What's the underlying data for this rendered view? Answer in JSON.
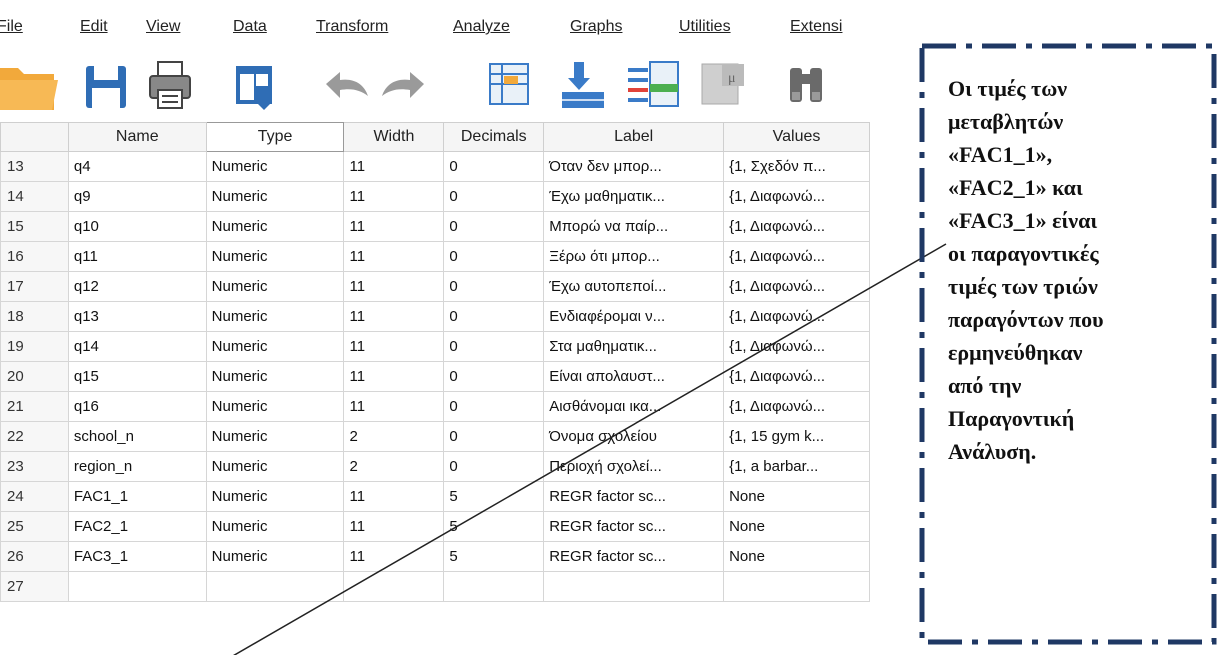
{
  "menu": {
    "items": [
      "File",
      "Edit",
      "View",
      "Data",
      "Transform",
      "Analyze",
      "Graphs",
      "Utilities",
      "Extensi"
    ]
  },
  "toolbar": {
    "icons": [
      "open-folder-icon",
      "save-icon",
      "print-icon",
      "dialog-recall-icon",
      "undo-icon",
      "redo-icon",
      "go-to-case-icon",
      "go-to-variable-icon",
      "variables-icon",
      "run-descriptives-icon",
      "find-icon"
    ]
  },
  "grid": {
    "columns": [
      "",
      "Name",
      "Type",
      "Width",
      "Decimals",
      "Label",
      "Values"
    ],
    "rows": [
      {
        "num": "13",
        "name": "q4",
        "type": "Numeric",
        "width": "11",
        "decimals": "0",
        "label": "Όταν δεν μπορ...",
        "values": "{1, Σχεδόν π..."
      },
      {
        "num": "14",
        "name": "q9",
        "type": "Numeric",
        "width": "11",
        "decimals": "0",
        "label": "Έχω μαθηματικ...",
        "values": "{1, Διαφωνώ..."
      },
      {
        "num": "15",
        "name": "q10",
        "type": "Numeric",
        "width": "11",
        "decimals": "0",
        "label": "Μπορώ να παίρ...",
        "values": "{1, Διαφωνώ..."
      },
      {
        "num": "16",
        "name": "q11",
        "type": "Numeric",
        "width": "11",
        "decimals": "0",
        "label": "Ξέρω ότι μπορ...",
        "values": "{1, Διαφωνώ..."
      },
      {
        "num": "17",
        "name": "q12",
        "type": "Numeric",
        "width": "11",
        "decimals": "0",
        "label": "Έχω αυτοπεποί...",
        "values": "{1, Διαφωνώ..."
      },
      {
        "num": "18",
        "name": "q13",
        "type": "Numeric",
        "width": "11",
        "decimals": "0",
        "label": "Ενδιαφέρομαι ν...",
        "values": "{1, Διαφωνώ..."
      },
      {
        "num": "19",
        "name": "q14",
        "type": "Numeric",
        "width": "11",
        "decimals": "0",
        "label": "Στα μαθηματικ...",
        "values": "{1, Διαφωνώ..."
      },
      {
        "num": "20",
        "name": "q15",
        "type": "Numeric",
        "width": "11",
        "decimals": "0",
        "label": "Είναι απολαυστ...",
        "values": "{1, Διαφωνώ..."
      },
      {
        "num": "21",
        "name": "q16",
        "type": "Numeric",
        "width": "11",
        "decimals": "0",
        "label": "Αισθάνομαι ικα...",
        "values": "{1, Διαφωνώ..."
      },
      {
        "num": "22",
        "name": "school_n",
        "type": "Numeric",
        "width": "2",
        "decimals": "0",
        "label": "Όνομα σχολείου",
        "values": "{1, 15 gym k..."
      },
      {
        "num": "23",
        "name": "region_n",
        "type": "Numeric",
        "width": "2",
        "decimals": "0",
        "label": "Περιοχή σχολεί...",
        "values": "{1, a barbar..."
      },
      {
        "num": "24",
        "name": "FAC1_1",
        "type": "Numeric",
        "width": "11",
        "decimals": "5",
        "label": "REGR factor sc...",
        "values": "None"
      },
      {
        "num": "25",
        "name": "FAC2_1",
        "type": "Numeric",
        "width": "11",
        "decimals": "5",
        "label": "REGR factor sc...",
        "values": "None"
      },
      {
        "num": "26",
        "name": "FAC3_1",
        "type": "Numeric",
        "width": "11",
        "decimals": "5",
        "label": "REGR factor sc...",
        "values": "None"
      },
      {
        "num": "27",
        "name": "",
        "type": "",
        "width": "",
        "decimals": "",
        "label": "",
        "values": ""
      }
    ]
  },
  "callout": {
    "lines": [
      "Οι τιμές των",
      "μεταβλητών",
      "«FAC1_1»,",
      "«FAC2_1» και",
      "«FAC3_1» είναι",
      "οι παραγοντικές",
      "τιμές των τριών",
      "παραγόντων που",
      "ερμηνεύθηκαν",
      "από την",
      "Παραγοντική",
      "Ανάλυση."
    ]
  },
  "colors": {
    "frame": "#1f3864",
    "folder": "#f4a23c",
    "save_blue": "#2f6db5"
  }
}
